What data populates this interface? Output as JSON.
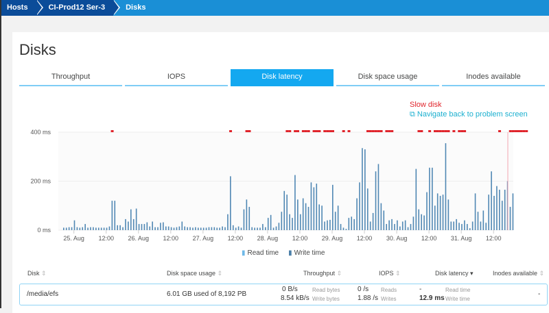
{
  "breadcrumb": [
    "Hosts",
    "CI-Prod12 Ser-3",
    "Disks"
  ],
  "page_title": "Disks",
  "tabs": [
    {
      "label": "Throughput"
    },
    {
      "label": "IOPS"
    },
    {
      "label": "Disk latency",
      "active": true
    },
    {
      "label": "Disk space usage"
    },
    {
      "label": "Inodes available"
    }
  ],
  "event": {
    "title": "Slow disk",
    "link": "Navigate back to problem screen"
  },
  "chart_data": {
    "type": "bar",
    "ylabel": "",
    "xlabel": "",
    "ylim": [
      0,
      400
    ],
    "y_ticks": [
      "0 ms",
      "200 ms",
      "400 ms"
    ],
    "x_ticks": [
      {
        "label": "25. Aug",
        "at": 4
      },
      {
        "label": "12:00",
        "at": 16
      },
      {
        "label": "26. Aug",
        "at": 28
      },
      {
        "label": "12:00",
        "at": 40
      },
      {
        "label": "27. Aug",
        "at": 52
      },
      {
        "label": "12:00",
        "at": 64
      },
      {
        "label": "28. Aug",
        "at": 76
      },
      {
        "label": "12:00",
        "at": 88
      },
      {
        "label": "29. Aug",
        "at": 100
      },
      {
        "label": "12:00",
        "at": 112
      },
      {
        "label": "30. Aug",
        "at": 124
      },
      {
        "label": "12:00",
        "at": 136
      },
      {
        "label": "31. Aug",
        "at": 148
      },
      {
        "label": "12:00",
        "at": 160
      }
    ],
    "legend": [
      "Read time",
      "Write time"
    ],
    "series": [
      {
        "name": "Write time",
        "color": "#4f87b3",
        "values": [
          10,
          10,
          12,
          12,
          40,
          12,
          10,
          12,
          25,
          10,
          12,
          12,
          10,
          10,
          10,
          10,
          10,
          15,
          120,
          120,
          20,
          20,
          12,
          45,
          35,
          85,
          45,
          88,
          25,
          25,
          25,
          32,
          15,
          35,
          12,
          12,
          30,
          32,
          15,
          15,
          12,
          10,
          12,
          15,
          35,
          15,
          12,
          12,
          10,
          12,
          10,
          10,
          10,
          10,
          12,
          12,
          12,
          10,
          10,
          15,
          12,
          65,
          220,
          20,
          10,
          15,
          10,
          85,
          125,
          95,
          12,
          10,
          10,
          10,
          25,
          12,
          50,
          62,
          10,
          15,
          30,
          75,
          160,
          145,
          65,
          50,
          225,
          125,
          65,
          130,
          110,
          95,
          195,
          175,
          190,
          105,
          100,
          35,
          40,
          42,
          185,
          75,
          100,
          25,
          10,
          5,
          50,
          55,
          45,
          130,
          195,
          335,
          330,
          170,
          35,
          70,
          240,
          270,
          110,
          80,
          25,
          40,
          45,
          25,
          40,
          15,
          35,
          40,
          12,
          25,
          55,
          250,
          85,
          65,
          60,
          155,
          255,
          255,
          100,
          150,
          140,
          145,
          355,
          125,
          35,
          35,
          45,
          30,
          25,
          40,
          25,
          8,
          35,
          150,
          75,
          35,
          80,
          30,
          145,
          240,
          140,
          180,
          165,
          120,
          165,
          200,
          95,
          150
        ]
      }
    ],
    "slow_disk_markers": [
      18,
      62,
      68,
      69,
      83,
      84,
      86,
      87,
      89,
      90,
      91,
      93,
      94,
      95,
      97,
      98,
      99,
      100,
      104,
      106,
      113,
      114,
      115,
      116,
      117,
      118,
      120,
      121,
      122,
      132,
      133,
      136,
      138,
      139,
      140,
      141,
      142,
      143,
      145,
      147,
      148,
      149,
      162,
      166,
      167,
      168,
      169,
      170,
      171,
      172
    ],
    "marker_color": "#e0242b",
    "threshold_color": "#f3a6b0"
  },
  "table": {
    "headers": [
      "Disk",
      "Disk space usage",
      "Throughput",
      "IOPS",
      "Disk latency",
      "Inodes available"
    ],
    "sort_icon": "sort-icon",
    "sorted_column": "Disk latency",
    "rows": [
      {
        "disk": "/media/efs",
        "space": "6.01 GB used of 8,192 PB",
        "throughput_read": "0 B/s",
        "throughput_read_label": "Read bytes",
        "throughput_write": "8.54 kB/s",
        "throughput_write_label": "Write bytes",
        "iops_read": "0 /s",
        "iops_read_label": "Reads",
        "iops_write": "1.88 /s",
        "iops_write_label": "Writes",
        "latency_read": "-",
        "latency_read_label": "Read time",
        "latency_write": "12.9 ms",
        "latency_write_label": "Write time",
        "inodes": "-"
      }
    ]
  }
}
